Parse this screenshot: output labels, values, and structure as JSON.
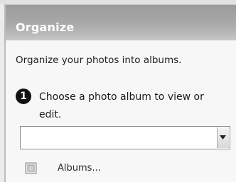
{
  "panel": {
    "title": "Organize",
    "description": "Organize your photos into albums.",
    "step": {
      "number": "1",
      "text": "Choose a photo album to view or edit."
    },
    "album_select": {
      "value": "",
      "arrow_icon": "dropdown-arrow-icon"
    },
    "albums_link": {
      "label": "Albums...",
      "icon": "album-icon"
    }
  },
  "colors": {
    "header": "#a6a6a6",
    "title_text": "#ffffff",
    "panel_bg": "#f7f7f7"
  }
}
